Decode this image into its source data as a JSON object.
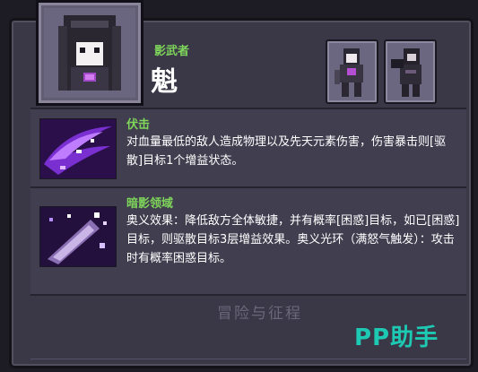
{
  "hero": {
    "role": "影武者",
    "name": "魁"
  },
  "skills": [
    {
      "title": "伏击",
      "description": "对血量最低的敌人造成物理以及先天元素伤害，伤害暴击则[驱散]目标1个增益状态。"
    },
    {
      "title": "暗影领域",
      "description": "奥义效果：降低敌方全体敏捷，并有概率[困惑]目标，如已[困惑]目标，则驱散目标3层增益效果。奥义光环（满怒气触发）：攻击时有概率困惑目标。"
    }
  ],
  "footer": {
    "game_logo": "冒险与征程",
    "watermark": "PP助手"
  },
  "icons": [
    "hero-portrait-icon",
    "skin-icon",
    "skin-icon",
    "ambush-skill-icon",
    "shadow-domain-skill-icon"
  ],
  "colors": {
    "accent_green": "#7fd65a",
    "watermark": "#1ec9b3"
  }
}
